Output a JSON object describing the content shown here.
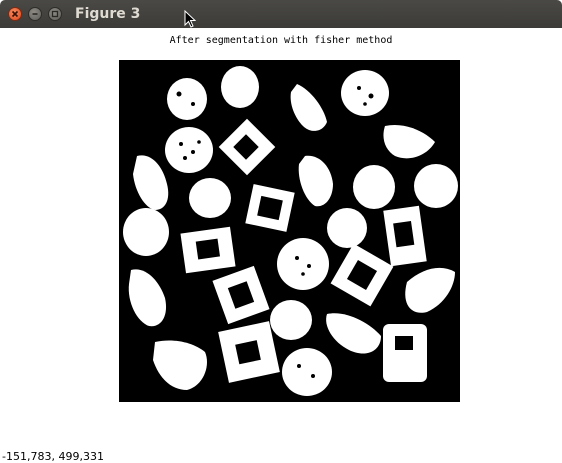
{
  "window": {
    "title": "Figure 3",
    "buttons": [
      "close-icon",
      "minimize-icon",
      "maximize-icon"
    ]
  },
  "figure": {
    "title": "After segmentation with fisher method",
    "image": "binary-segmentation-mask"
  },
  "status": {
    "coordinates": "-151,783,  499,331"
  },
  "colors": {
    "titlebar": "#3c3b37",
    "close": "#e0491f",
    "plot_background": "#000000",
    "foreground": "#ffffff"
  }
}
